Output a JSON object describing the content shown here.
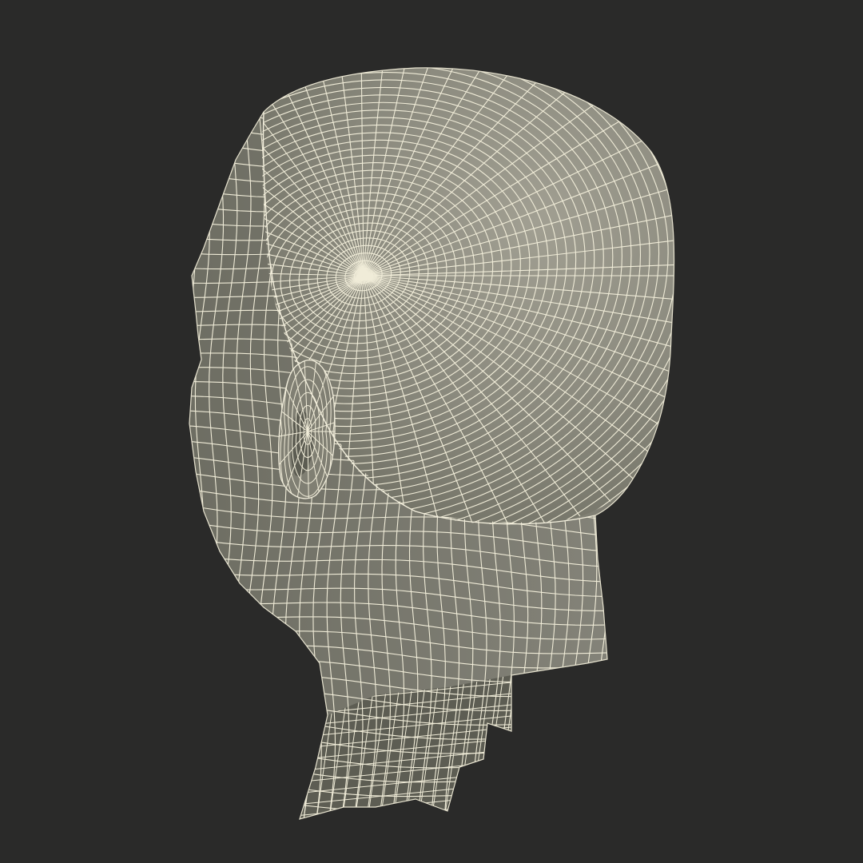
{
  "render": {
    "background_color": "#2a2a29",
    "mesh_fill_color": "#8a8a7d",
    "mesh_shadow_color": "#6e6e63",
    "mesh_highlight_color": "#a09f92",
    "wire_color": "#f0ecd8",
    "interior_color": "#55554c",
    "subject": "human-head-wireframe"
  }
}
